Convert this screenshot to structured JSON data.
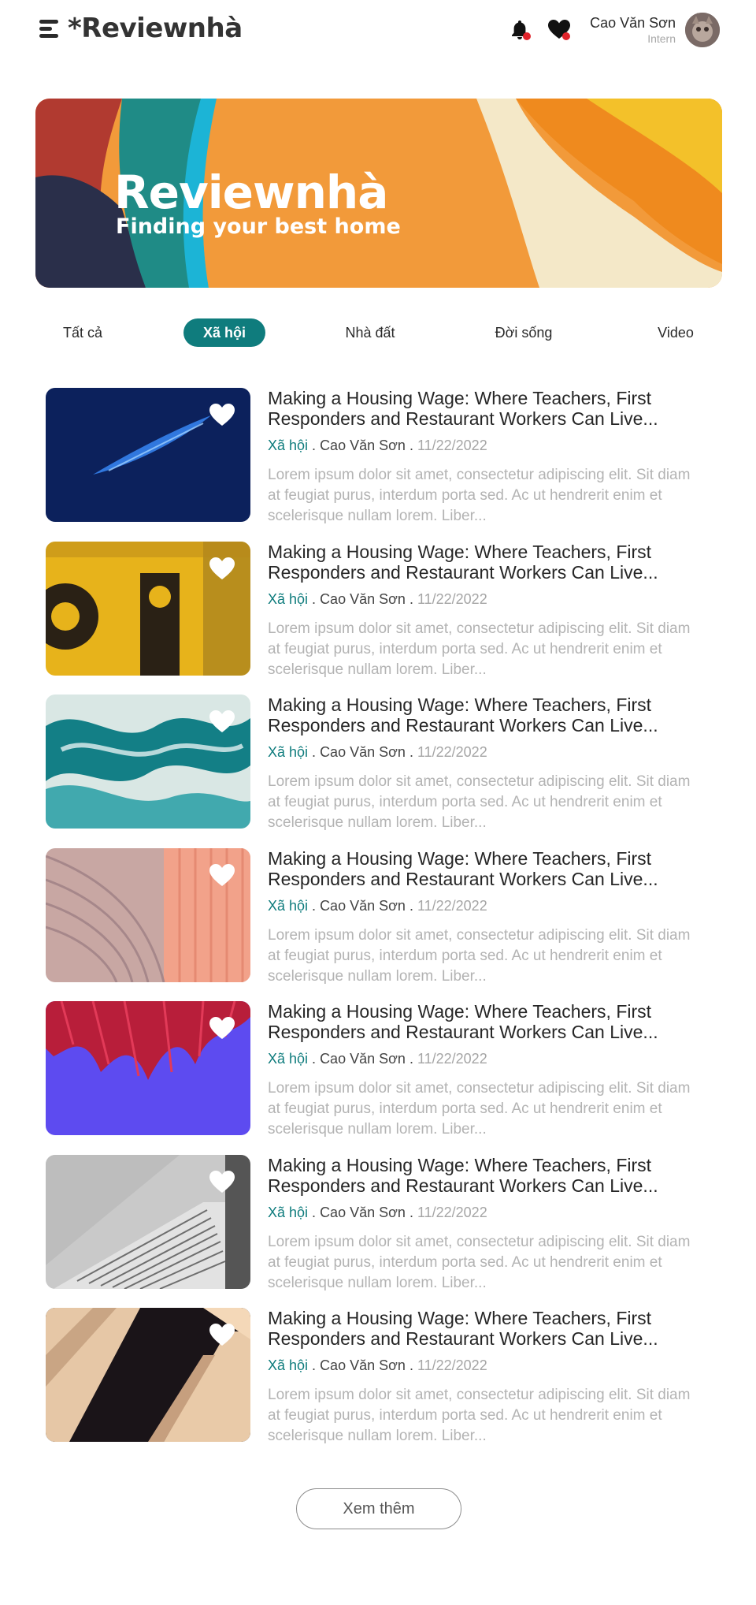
{
  "header": {
    "logo_text": "*Reviewnhà",
    "user_name": "Cao Văn Sơn",
    "user_role": "Intern"
  },
  "banner": {
    "title": "Reviewnhà",
    "subtitle": "Finding your best home"
  },
  "tabs": [
    {
      "label": "Tất cả",
      "active": false
    },
    {
      "label": "Xã hội",
      "active": true
    },
    {
      "label": "Nhà đất",
      "active": false
    },
    {
      "label": "Đời sống",
      "active": false
    },
    {
      "label": "Video",
      "active": false
    }
  ],
  "posts": [
    {
      "title": "Making a Housing Wage: Where Teachers, First Responders and Restaurant Workers Can Live...",
      "category": "Xã hội",
      "author": "Cao Văn Sơn",
      "date": "11/22/2022",
      "excerpt": "Lorem ipsum dolor sit amet, consectetur adipiscing elit. Sit diam at feugiat purus, interdum porta sed. Ac ut hendrerit enim et scelerisque nullam lorem. Liber...",
      "image": "dark-blue-light-streak"
    },
    {
      "title": "Making a Housing Wage: Where Teachers, First Responders and Restaurant Workers Can Live...",
      "category": "Xã hội",
      "author": "Cao Văn Sơn",
      "date": "11/22/2022",
      "excerpt": "Lorem ipsum dolor sit amet, consectetur adipiscing elit. Sit diam at feugiat purus, interdum porta sed. Ac ut hendrerit enim et scelerisque nullam lorem. Liber...",
      "image": "yellow-grunge-wall"
    },
    {
      "title": "Making a Housing Wage: Where Teachers, First Responders and Restaurant Workers Can Live...",
      "category": "Xã hội",
      "author": "Cao Văn Sơn",
      "date": "11/22/2022",
      "excerpt": "Lorem ipsum dolor sit amet, consectetur adipiscing elit. Sit diam at feugiat purus, interdum porta sed. Ac ut hendrerit enim et scelerisque nullam lorem. Liber...",
      "image": "teal-marble-swirl"
    },
    {
      "title": "Making a Housing Wage: Where Teachers, First Responders and Restaurant Workers Can Live...",
      "category": "Xã hội",
      "author": "Cao Văn Sơn",
      "date": "11/22/2022",
      "excerpt": "Lorem ipsum dolor sit amet, consectetur adipiscing elit. Sit diam at feugiat purus, interdum porta sed. Ac ut hendrerit enim et scelerisque nullam lorem. Liber...",
      "image": "peach-curved-lines"
    },
    {
      "title": "Making a Housing Wage: Where Teachers, First Responders and Restaurant Workers Can Live...",
      "category": "Xã hội",
      "author": "Cao Văn Sơn",
      "date": "11/22/2022",
      "excerpt": "Lorem ipsum dolor sit amet, consectetur adipiscing elit. Sit diam at feugiat purus, interdum porta sed. Ac ut hendrerit enim et scelerisque nullam lorem. Liber...",
      "image": "red-plant-purple-sky"
    },
    {
      "title": "Making a Housing Wage: Where Teachers, First Responders and Restaurant Workers Can Live...",
      "category": "Xã hội",
      "author": "Cao Văn Sơn",
      "date": "11/22/2022",
      "excerpt": "Lorem ipsum dolor sit amet, consectetur adipiscing elit. Sit diam at feugiat purus, interdum porta sed. Ac ut hendrerit enim et scelerisque nullam lorem. Liber...",
      "image": "grey-architecture-stairs"
    },
    {
      "title": "Making a Housing Wage: Where Teachers, First Responders and Restaurant Workers Can Live...",
      "category": "Xã hội",
      "author": "Cao Văn Sơn",
      "date": "11/22/2022",
      "excerpt": "Lorem ipsum dolor sit amet, consectetur adipiscing elit. Sit diam at feugiat purus, interdum porta sed. Ac ut hendrerit enim et scelerisque nullam lorem. Liber...",
      "image": "beige-building-facade"
    }
  ],
  "more_button": "Xem thêm",
  "colors": {
    "accent": "#0f7c7d",
    "notification_dot": "#e0232b",
    "meta_date": "#a5a5a5",
    "excerpt": "#b3b3b3"
  },
  "icons": {
    "menu": "menu-icon",
    "bell": "bell-icon",
    "favorites": "heart-icon",
    "post_favorite": "heart-icon"
  }
}
